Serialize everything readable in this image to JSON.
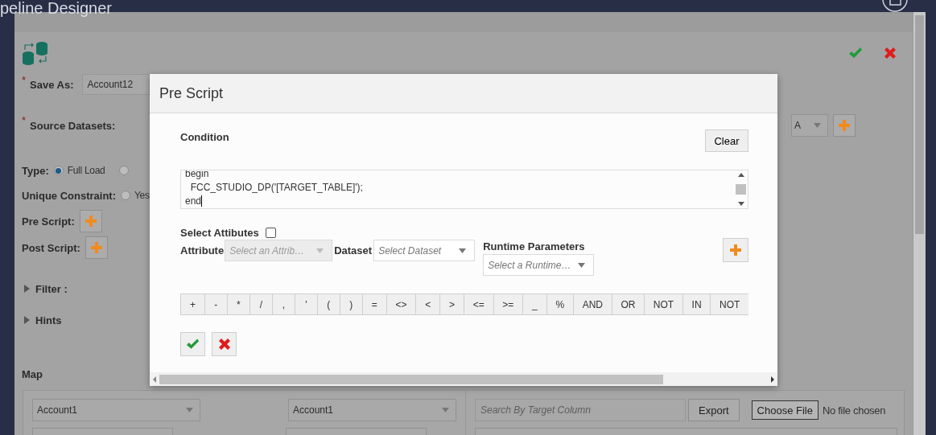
{
  "app": {
    "title": "peline Designer"
  },
  "editor": {
    "save_as": {
      "marker": "*",
      "label": "Save As:",
      "value": "Account12"
    },
    "source_datasets": {
      "marker": "*",
      "label": "Source Datasets:",
      "value": "A"
    },
    "type": {
      "label": "Type:",
      "options": [
        {
          "label": "Full Load",
          "selected": true
        },
        {
          "selected": false
        }
      ]
    },
    "unique_constraint": {
      "label": "Unique Constraint:",
      "options": [
        {
          "label": "Yes",
          "selected": false
        }
      ]
    },
    "pre_script": {
      "label": "Pre Script:"
    },
    "post_script": {
      "label": "Post Script:"
    },
    "sections": [
      {
        "label": "Filter :",
        "expanded": false
      },
      {
        "label": "Hints",
        "expanded": false
      }
    ],
    "map": {
      "title": "Map",
      "source_select": "Account1",
      "target_select": "Account1",
      "search": {
        "placeholder": "Search By Target Column"
      },
      "export": "Export",
      "file_button": "Choose File",
      "file_status": "No file chosen"
    }
  },
  "dialog": {
    "title": "Pre Script",
    "condition_label": "Condition",
    "clear": "Clear",
    "script_lines": [
      "begin",
      "  FCC_STUDIO_DP('[TARGET_TABLE]');",
      "end"
    ],
    "select_attributes": {
      "label": "Select Attibutes",
      "checked": false
    },
    "attribute": {
      "label": "Attribute",
      "placeholder": "Select an Attrib…",
      "disabled": true
    },
    "dataset": {
      "label": "Dataset",
      "placeholder": "Select Dataset",
      "disabled": false
    },
    "runtime": {
      "label": "Runtime Parameters",
      "placeholder": "Select a Runtime…",
      "disabled": false
    },
    "operators": [
      "+",
      "-",
      "*",
      "/",
      ",",
      "'",
      "(",
      ")",
      "=",
      "<>",
      "<",
      ">",
      "<=",
      ">=",
      "_",
      "%",
      "AND",
      "OR",
      "NOT",
      "IN",
      "NOT"
    ]
  }
}
